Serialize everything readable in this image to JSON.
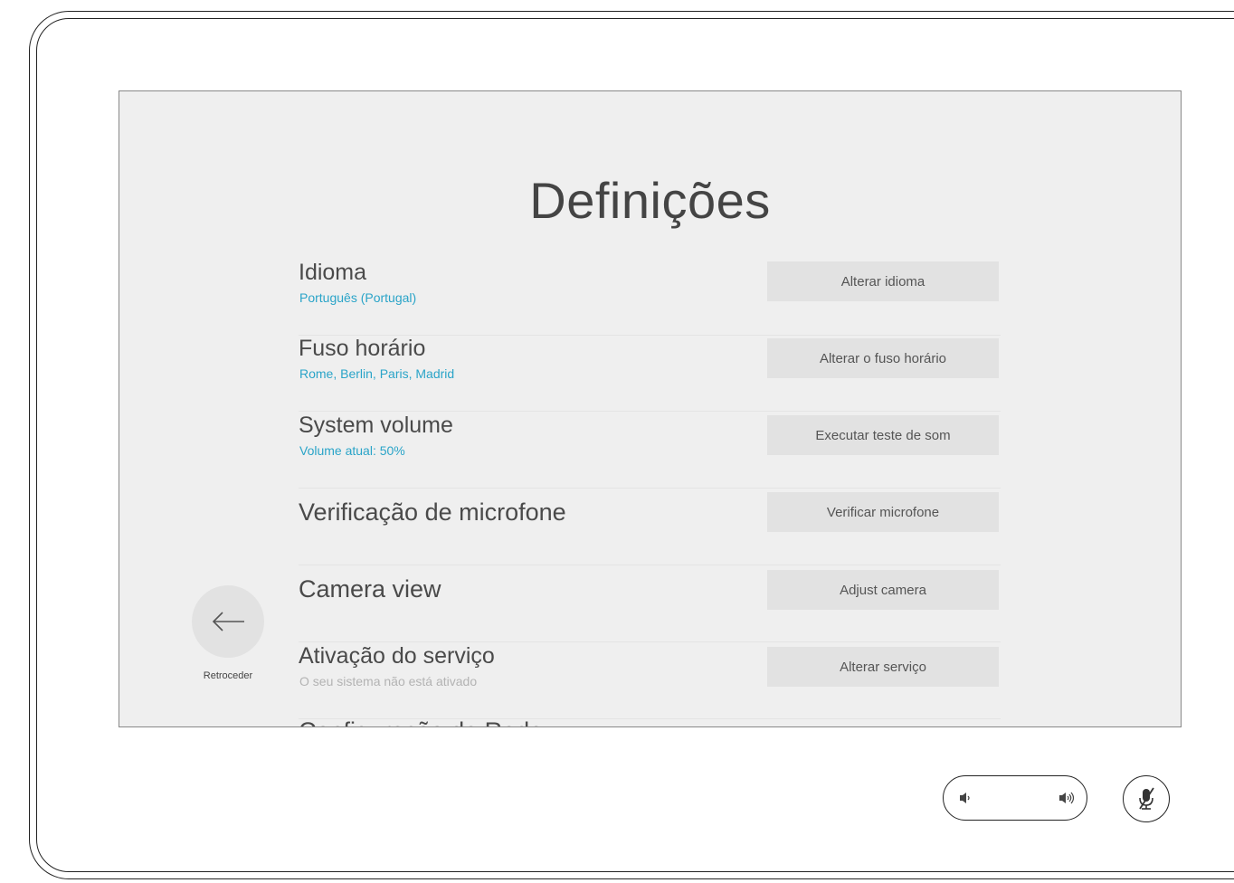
{
  "page": {
    "title": "Definições"
  },
  "back": {
    "label": "Retroceder"
  },
  "settings": [
    {
      "label": "Idioma",
      "sub": "Português (Portugal)",
      "button": "Alterar idioma"
    },
    {
      "label": "Fuso horário",
      "sub": "Rome, Berlin, Paris, Madrid",
      "button": "Alterar o fuso horário"
    },
    {
      "label": "System volume",
      "sub": "Volume atual: 50%",
      "button": "Executar teste de som"
    },
    {
      "label": "Verificação de microfone",
      "sub": "",
      "button": "Verificar microfone"
    },
    {
      "label": "Camera view",
      "sub": "",
      "button": "Adjust camera"
    },
    {
      "label": "Ativação do serviço",
      "sub": "O seu sistema não está ativado",
      "button": "Alterar serviço"
    },
    {
      "label": "Configuração de Rede",
      "sub": "",
      "button": ""
    }
  ],
  "colors": {
    "accent": "#2aa4c8",
    "screen_bg": "#efefef",
    "button_bg": "#e2e2e2"
  },
  "icons": {
    "back": "arrow-left-icon",
    "volume_down": "volume-down-icon",
    "volume_up": "volume-up-icon",
    "mute": "microphone-muted-icon"
  }
}
